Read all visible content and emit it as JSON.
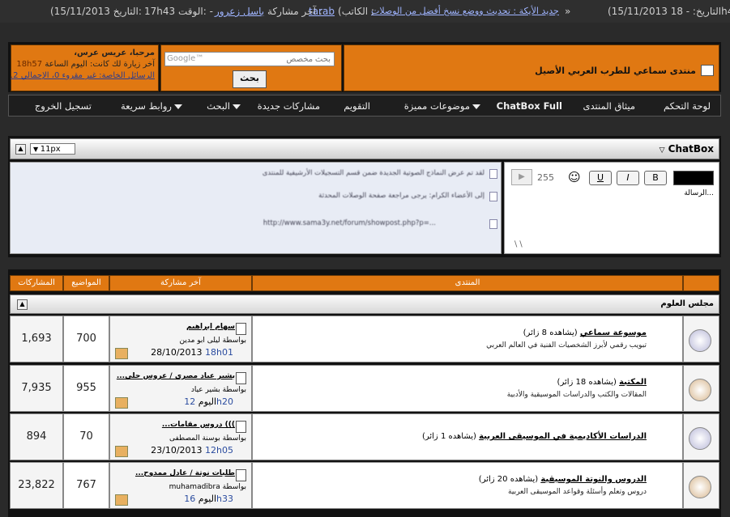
{
  "ticker": {
    "left_date_label": "التاريخ:",
    "left_date": "(15/11/2013",
    "time_label": "الوقت:",
    "time": "17h43",
    "author": "باسل زعرور",
    "last_post_label": "آخر مشاركة :",
    "author2": "tarab",
    "writer_label": "(الكاتب :",
    "news_link": "جديد الأيكة : تحديث ووضع نسخ أفضل من الوصلات",
    "arrow": "»",
    "right_time": "18h4",
    "right_date": "(15/11/2013"
  },
  "header": {
    "forum_title": "منتدى سماعي للطرب العربي الأصيل",
    "search_placeholder": "بحث مخصص",
    "search_logo": "Google™",
    "search_button": "بحث",
    "welcome": "مرحبا، عريس عرس،",
    "last_visit": "آخر زيارة لك كانت: اليوم الساعة",
    "last_visit_time": "18h57",
    "messages": "الرسائل الخاصة: غير مقروء 0، الإجمالي 2."
  },
  "navbar": {
    "items": [
      "لوحة التحكم",
      "ميثاق المنتدى",
      "ChatBox Full",
      "موضوعات مميزة",
      "التقويم",
      "مشاركات جديدة",
      "البحث",
      "روابط سريعة",
      "تسجيل الخروج"
    ]
  },
  "chatbox": {
    "title": "ChatBox",
    "font_size": "11px",
    "counter": "255",
    "message_label": "الرسالة...",
    "bold": "B",
    "italic": "I",
    "underline": "U",
    "messages": [
      "لقد تم عرض النماذج الصوتية الجديدة ضمن قسم التسجيلات الأرشيفية للمنتدى",
      "إلى الأعضاء الكرام: يرجى مراجعة صفحة الوصلات المحدثة",
      "http://www.sama3y.net/forum/showpost.php?p=..."
    ]
  },
  "forum": {
    "headers": {
      "forum": "المنتدى",
      "last_post": "آخر مشاركة",
      "threads": "المواضيع",
      "posts": "المشاركات"
    },
    "category": "مجلس العلوم",
    "rows": [
      {
        "title": "موسوعة سماعي",
        "viewers": "(يشاهده 8 زائر)",
        "desc": "تبويب رقمي لأبرز الشخصيات الفنية في العالم العربي",
        "lp_title": "سهام ابراهيم",
        "lp_by": "بواسطة ليلى ابو مدين",
        "lp_date": "28/10/2013",
        "lp_time": "18h01",
        "threads": "700",
        "posts": "1,693"
      },
      {
        "title": "المكتبة",
        "viewers": "(يشاهده 18 زائر)",
        "desc": "المقالات والكتب والدراسات الموسيقية والأدبية",
        "lp_title": "بشير عياد مصري / عروس حلي...",
        "lp_by": "بواسطة بشير عياد",
        "lp_date": "اليوم",
        "lp_time": "12h20",
        "threads": "955",
        "posts": "7,935"
      },
      {
        "title": "الدراسات الأكاديمية في الموسيقى العربية",
        "viewers": "(يشاهده 1 زائر)",
        "desc": "",
        "lp_title": "))) دروس مقامات...",
        "lp_by": "بواسطة بوسنة المصطفى",
        "lp_date": "23/10/2013",
        "lp_time": "12h05",
        "threads": "70",
        "posts": "894"
      },
      {
        "title": "الدروس والنوتة الموسيقية",
        "viewers": "(يشاهده 20 زائر)",
        "desc": "دروس وتعلم وأسئلة وقواعد الموسيقى العربية",
        "lp_title": "طلبات نوتة / عادل ممدوح...",
        "lp_by": "بواسطة muhamadibra",
        "lp_date": "اليوم",
        "lp_time": "16h33",
        "threads": "767",
        "posts": "23,822"
      }
    ]
  }
}
